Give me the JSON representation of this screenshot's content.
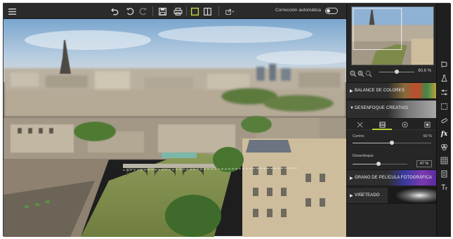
{
  "toolbar": {
    "icons": [
      "menu-icon",
      "undo-icon",
      "redo-icon",
      "redo-alt-icon",
      "save-icon",
      "print-icon",
      "crop-view-icon",
      "split-view-icon",
      "share-icon"
    ],
    "auto_correction_label": "Corrección automática",
    "auto_correction_on": false,
    "accent_color": "#c8d640"
  },
  "navigator": {
    "zoom_value": "60,6 %",
    "zoom_fraction": 0.5
  },
  "panel": {
    "sections": {
      "color_balance": "BALANCE DE COLORES",
      "creative_blur": "DESENFOQUE CREATIVO",
      "film_grain": "GRANO DE PELÍCULA FOTOGRÁFICA",
      "vignette": "VIÑETEADO"
    },
    "blur": {
      "tabs": [
        "none-tab",
        "linear-tab",
        "radial-tab",
        "full-tab"
      ],
      "active_tab": 1,
      "center_label": "Centro",
      "center_value": "50 %",
      "center_fraction": 0.5,
      "blur_label": "Desenfoque",
      "blur_value": "47 %",
      "blur_fraction": 0.47
    }
  },
  "tool_strip": {
    "icons": [
      "perspective-icon",
      "lab-flask-icon",
      "sliders-icon",
      "selection-icon",
      "heal-icon",
      "fx-effects-icon",
      "color-filter-icon",
      "texture-grid-icon",
      "layers-icon",
      "text-icon"
    ],
    "fx_label": "fx"
  }
}
